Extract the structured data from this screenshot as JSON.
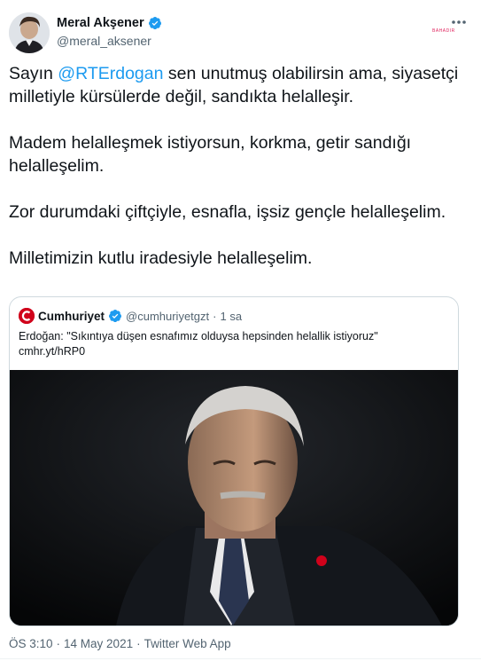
{
  "author": {
    "display_name": "Meral Akşener",
    "handle": "@meral_aksener",
    "verified_icon": "verified-badge-icon"
  },
  "top_tag": "BAHADIR",
  "tweet": {
    "line1_prefix": "Sayın ",
    "mention": "@RTErdogan",
    "line1_suffix": " sen unutmuş olabilirsin ama, siyasetçi milletiyle kürsülerde değil, sandıkta helalleşir.",
    "para2": "Madem helalleşmek istiyorsun, korkma, getir sandığı helalleşelim.",
    "para3": "Zor durumdaki çiftçiyle, esnafla, işsiz gençle helalleşelim.",
    "para4": "Milletimizin kutlu iradesiyle helalleşelim."
  },
  "quoted": {
    "name": "Cumhuriyet",
    "handle": "@cumhuriyetgzt",
    "separator": "·",
    "time": "1 sa",
    "text": "Erdoğan: \"Sıkıntıya düşen esnafımız olduysa hepsinden helallik istiyoruz\"",
    "link": "cmhr.yt/hRP0",
    "logo_color": "#d0021b"
  },
  "meta": {
    "time": "ÖS 3:10",
    "sep1": "·",
    "date": "14 May 2021",
    "sep2": "·",
    "source": "Twitter Web App"
  },
  "colors": {
    "accent": "#1d9bf0",
    "text": "#0f1419",
    "secondary": "#536471",
    "border": "#cfd9de"
  }
}
